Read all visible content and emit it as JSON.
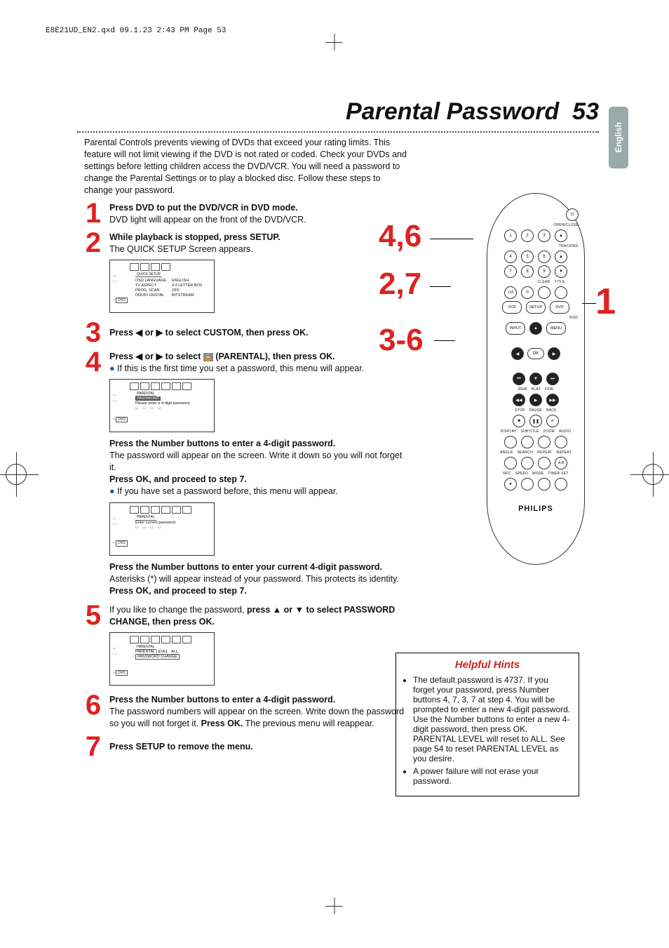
{
  "meta": {
    "header": "E8E21UD_EN2.qxd  09.1.23  2:43 PM  Page 53"
  },
  "langTab": "English",
  "title": {
    "text": "Parental Password",
    "page": "53"
  },
  "intro": "Parental Controls prevents viewing of DVDs that exceed your rating limits. This feature will not limit viewing if the DVD is not rated or coded. Check your DVDs and settings before letting children access the DVD/VCR. You will need a password to change the Parental Settings or to play a blocked disc. Follow these steps to change your password.",
  "steps": {
    "s1": {
      "num": "1",
      "b": "Press DVD to put the DVD/VCR in DVD mode.",
      "t": "DVD light will appear on the front of the DVD/VCR."
    },
    "s2": {
      "num": "2",
      "b": "While playback is stopped, press SETUP.",
      "t": "The QUICK SETUP Screen appears."
    },
    "screenA": {
      "tab": "QUICK SETUP",
      "left": "OSD LANGUAGE\nTV ASPECT\nPROG. SCAN\nDOLBY DIGITAL",
      "right": "ENGLISH\n4:3 LETTER BOX\nOFF\nBITSTREAM"
    },
    "s3": {
      "num": "3",
      "b": "Press ◀ or ▶ to select CUSTOM, then press OK."
    },
    "s4": {
      "num": "4",
      "b1": "Press ◀ or ▶ to select ",
      "b2": " (PARENTAL), then press OK.",
      "bul": "If this is the first time you set a password, this menu will appear."
    },
    "screenB": {
      "tab": "PARENTAL",
      "hi": "PASSWORD",
      "msg": "Please enter a 4-digit password.",
      "boxes": "□ □ □ □"
    },
    "s4c": {
      "a": "Press the Number buttons to enter a 4-digit password.",
      "b": "The password will appear on the screen. Write it down so you will not forget it.",
      "c": "Press OK, and proceed to step 7.",
      "bul": "If you have set a password before, this menu will appear."
    },
    "screenC": {
      "tab": "PARENTAL",
      "msg": "Enter current password.",
      "boxes": "□ □ □ □"
    },
    "s4d": {
      "a": "Press the Number buttons to enter your current 4-digit password.",
      "b": " Asterisks (*) will appear instead of your password. This protects its identity. ",
      "c": "Press OK, and proceed to step 7."
    },
    "s5": {
      "num": "5",
      "t1": "If you like to change the password, ",
      "b1": "press ▲ or ▼ to select PASSWORD CHANGE, then press OK."
    },
    "screenD": {
      "tab": "PARENTAL",
      "row1a": "PARENTAL LEVEL",
      "row1b": "ALL",
      "row2": "PASSWORD CHANGE"
    },
    "s6": {
      "num": "6",
      "b": "Press the Number buttons to enter a 4-digit password.",
      "t1": "The password numbers will appear on the screen. Write down the password so you will not forget it. ",
      "b2": "Press OK.",
      "t2": " The previous menu will reappear."
    },
    "s7": {
      "num": "7",
      "b": "Press SETUP to remove the menu."
    }
  },
  "hints": {
    "title": "Helpful Hints",
    "h1": "The default password is 4737. If you forget your password, press Number buttons 4, 7, 3, 7 at step 4. You will be prompted to enter a new 4-digit password. Use the Number buttons to enter a new 4-digit password, then press OK. PARENTAL LEVEL will reset to ALL. See page 54 to reset PARENTAL LEVEL as you desire.",
    "h2": "A power failure will not erase your password."
  },
  "refs": {
    "a": "4,6",
    "b": "2,7",
    "c": "3-6",
    "d": "1"
  },
  "remote": {
    "openClose": "OPEN/CLOSE",
    "tracking": "TRACKING",
    "n": [
      "1",
      "2",
      "3",
      "4",
      "5",
      "6",
      "7",
      "8",
      "9",
      "+10",
      "0"
    ],
    "clear": "CLEAR",
    "title": "TITLE",
    "vcr": "VCR",
    "setup": "SETUP",
    "dvd": "DVD",
    "disc": "DISC",
    "input": "INPUT",
    "menu": "MENU",
    "ok": "OK",
    "rew": "REW",
    "play": "PLAY",
    "ffw": "FFW",
    "stop": "STOP",
    "pause": "PAUSE",
    "back": "BACK",
    "row1": [
      "DISPLAY",
      "SUBTITLE",
      "ZOOM",
      "AUDIO"
    ],
    "row2": [
      "ANGLE",
      "SEARCH",
      "REPEAT",
      "REPEAT"
    ],
    "ab": "A-B",
    "row3": [
      "REC",
      "SPEED",
      "MODE",
      "TIMER SET"
    ],
    "brand": "PHILIPS"
  }
}
